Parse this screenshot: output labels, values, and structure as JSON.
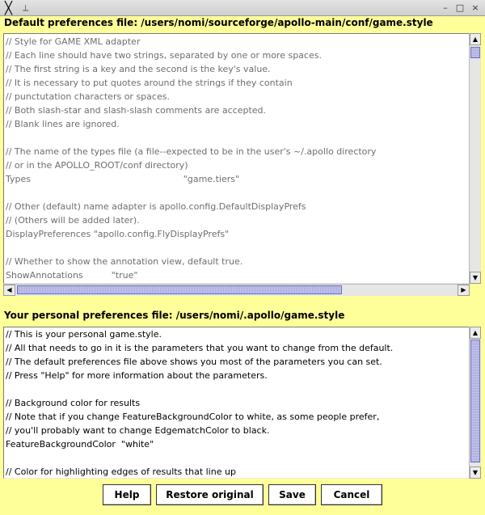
{
  "window": {
    "close_glyph": "╳",
    "pin_glyph": "⟂",
    "minimize_glyph": "–",
    "maximize_glyph": "□",
    "close_button_glyph": "×"
  },
  "default_section": {
    "header": "Default preferences file: /users/nomi/sourceforge/apollo-main/conf/game.style",
    "lines": [
      "// Style for GAME XML adapter",
      "// Each line should have two strings, separated by one or more spaces.",
      "// The first string is a key and the second is the key's value.",
      "// It is necessary to put quotes around the strings if they contain",
      "// punctutation characters or spaces.",
      "// Both slash-star and slash-slash comments are accepted.",
      "// Blank lines are ignored.",
      "",
      "// The name of the types file (a file--expected to be in the user's ~/.apollo directory",
      "// or in the APOLLO_ROOT/conf directory)",
      "Types                                                      \"game.tiers\"",
      "",
      "// Other (default) name adapter is apollo.config.DefaultDisplayPrefs",
      "// (Others will be added later).",
      "DisplayPreferences \"apollo.config.FlyDisplayPrefs\"",
      "",
      "// Whether to show the annotation view, default true.",
      "ShowAnnotations          \"true\""
    ]
  },
  "personal_section": {
    "header": "Your personal preferences file: /users/nomi/.apollo/game.style",
    "lines": [
      "// This is your personal game.style.",
      "// All that needs to go in it is the parameters that you want to change from the default.",
      "// The default preferences file above shows you most of the parameters you can set.",
      "// Press \"Help\" for more information about the parameters.",
      "",
      "// Background color for results",
      "// Note that if you change FeatureBackgroundColor to white, as some people prefer,",
      "// you'll probably want to change EdgematchColor to black.",
      "FeatureBackgroundColor  \"white\"",
      "",
      "// Color for highlighting edges of results that line up"
    ]
  },
  "scroll_glyphs": {
    "up": "▲",
    "down": "▼",
    "left": "◀",
    "right": "▶"
  },
  "buttons": {
    "help": "Help",
    "restore": "Restore original",
    "save": "Save",
    "cancel": "Cancel"
  },
  "colors": {
    "background": "#ffff99",
    "scroll_thumb": "#a8a8e0",
    "default_text": "#6e6e6e",
    "personal_text": "#000000"
  }
}
